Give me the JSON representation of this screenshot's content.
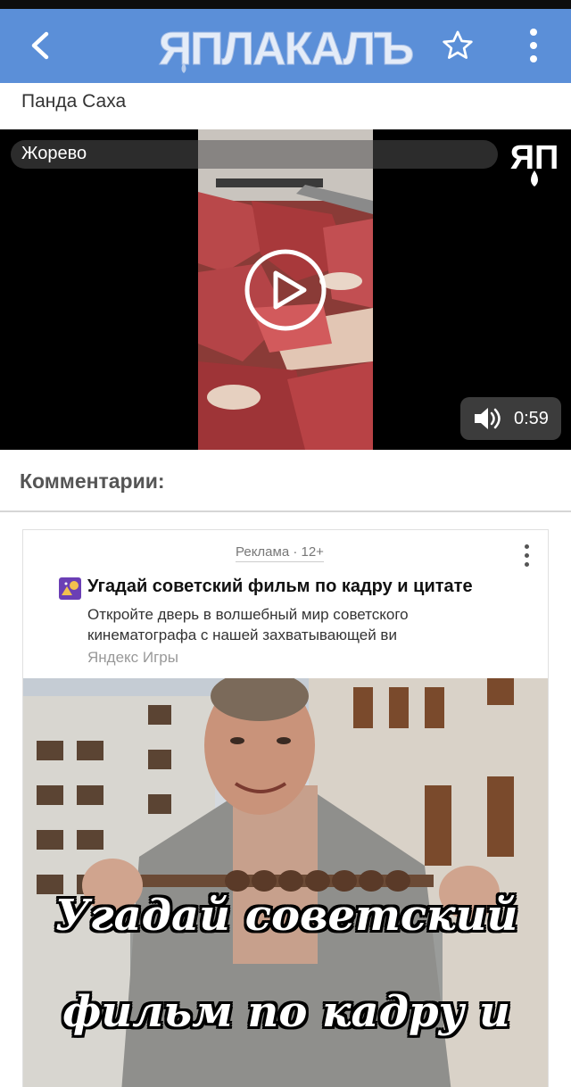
{
  "header": {
    "logo_text": "ЯПЛАКАЛЪ",
    "back_icon": "chevron-left-icon",
    "favorite_icon": "star-outline-icon",
    "menu_icon": "kebab-menu-icon"
  },
  "post": {
    "author": "Панда Саха"
  },
  "video": {
    "title": "Жорево",
    "watermark": "ЯП",
    "duration": "0:59",
    "play_icon": "play-circle-icon",
    "volume_icon": "speaker-icon"
  },
  "comments": {
    "heading": "Комментарии:"
  },
  "ad": {
    "label": "Реклама · 12+",
    "title": "Угадай советский фильм по кадру и цитате",
    "description": "Откройте дверь в волшебный мир советского кинематографа с нашей захватывающей ви",
    "source": "Яндекс Игры",
    "caption_line1": "Угадай советский",
    "caption_line2": "фильм по кадру и"
  },
  "colors": {
    "header_bg": "#5b8fd8",
    "status_bar": "#0d0d0d",
    "video_bg": "#000000"
  }
}
